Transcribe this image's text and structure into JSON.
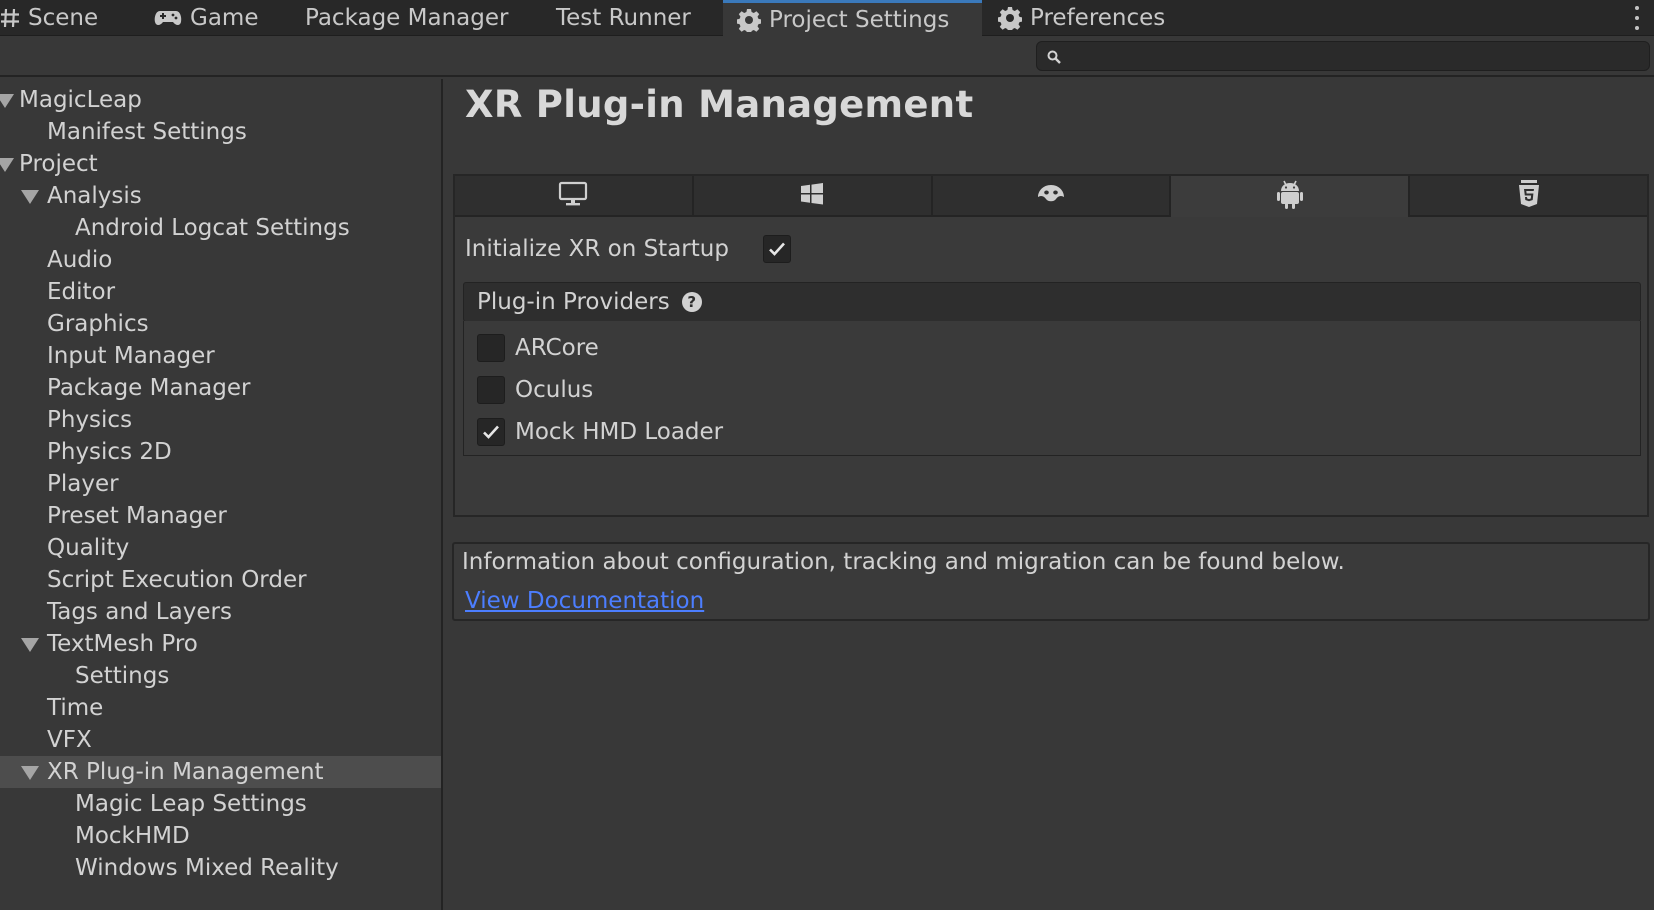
{
  "tabs": [
    {
      "label": "Scene",
      "icon": "grid-icon"
    },
    {
      "label": "Game",
      "icon": "gamepad-icon"
    },
    {
      "label": "Package Manager"
    },
    {
      "label": "Test Runner"
    },
    {
      "label": "Project Settings",
      "icon": "gear-icon",
      "active": true
    },
    {
      "label": "Preferences",
      "icon": "gear-icon"
    }
  ],
  "search": {
    "value": "",
    "placeholder": ""
  },
  "sidebar": {
    "items": [
      {
        "label": "MagicLeap",
        "expanded": true
      },
      {
        "label": "Manifest Settings"
      },
      {
        "label": "Project",
        "expanded": true
      },
      {
        "label": "Analysis",
        "expanded": true
      },
      {
        "label": "Android Logcat Settings"
      },
      {
        "label": "Audio"
      },
      {
        "label": "Editor"
      },
      {
        "label": "Graphics"
      },
      {
        "label": "Input Manager"
      },
      {
        "label": "Package Manager"
      },
      {
        "label": "Physics"
      },
      {
        "label": "Physics 2D"
      },
      {
        "label": "Player"
      },
      {
        "label": "Preset Manager"
      },
      {
        "label": "Quality"
      },
      {
        "label": "Script Execution Order"
      },
      {
        "label": "Tags and Layers"
      },
      {
        "label": "TextMesh Pro",
        "expanded": true
      },
      {
        "label": "Settings"
      },
      {
        "label": "Time"
      },
      {
        "label": "VFX"
      },
      {
        "label": "XR Plug-in Management",
        "expanded": true,
        "selected": true
      },
      {
        "label": "Magic Leap Settings"
      },
      {
        "label": "MockHMD"
      },
      {
        "label": "Windows Mixed Reality"
      }
    ]
  },
  "main": {
    "title": "XR Plug-in Management",
    "platform_tabs": [
      {
        "icon": "desktop-icon"
      },
      {
        "icon": "windows-icon"
      },
      {
        "icon": "magicleap-icon"
      },
      {
        "icon": "android-icon",
        "active": true
      },
      {
        "icon": "html5-icon"
      }
    ],
    "initialize_label": "Initialize XR on Startup",
    "initialize_checked": true,
    "providers_header": "Plug-in Providers",
    "providers": [
      {
        "label": "ARCore",
        "checked": false
      },
      {
        "label": "Oculus",
        "checked": false
      },
      {
        "label": "Mock HMD Loader",
        "checked": true
      }
    ],
    "info_text": "Information about configuration, tracking and migration can be found below.",
    "doc_link": "View Documentation"
  },
  "colors": {
    "accent": "#3a79bb",
    "link": "#4c7eff",
    "background": "#383838"
  }
}
